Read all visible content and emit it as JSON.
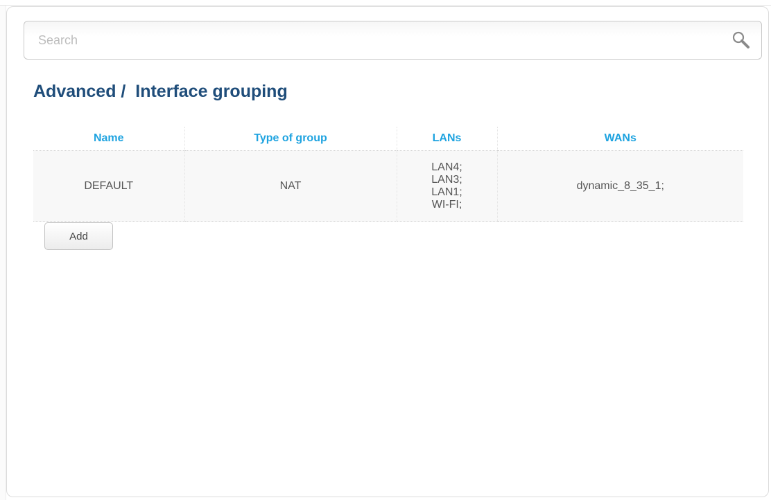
{
  "search": {
    "placeholder": "Search",
    "value": "",
    "icon": "search-icon"
  },
  "page": {
    "title": "Advanced /  Interface grouping"
  },
  "colors": {
    "title": "#1f4d7a",
    "column_header": "#1ea3e0",
    "cell_text": "#555555",
    "row_background": "#f8f8f8"
  },
  "table": {
    "columns": [
      "Name",
      "Type of group",
      "LANs",
      "WANs"
    ],
    "rows": [
      {
        "name": "DEFAULT",
        "type": "NAT",
        "lans": [
          "LAN4;",
          "LAN3;",
          "LAN1;",
          "WI-FI;"
        ],
        "wans": "dynamic_8_35_1;"
      }
    ]
  },
  "actions": {
    "add_label": "Add"
  }
}
